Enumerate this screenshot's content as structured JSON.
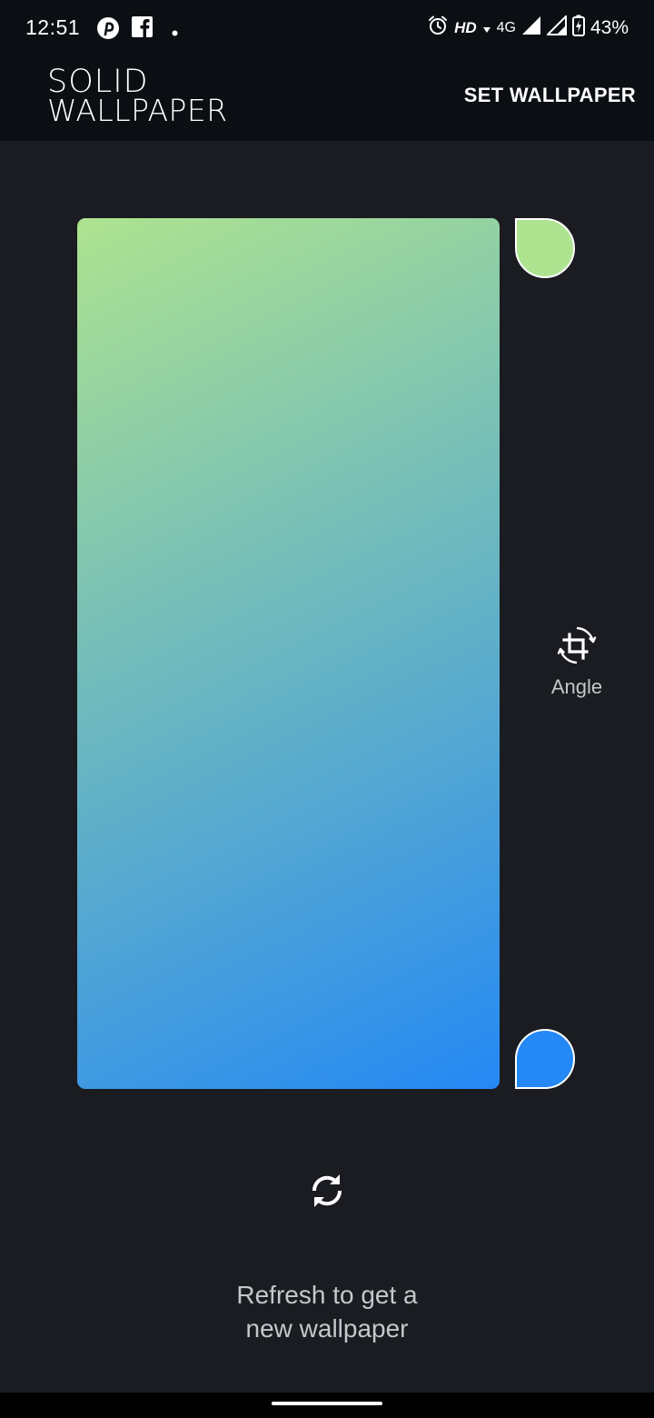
{
  "status_bar": {
    "time": "12:51",
    "icons_left": [
      "pinterest-icon",
      "facebook-icon",
      "notification-dot-icon"
    ],
    "hd": "HD",
    "network": "4G",
    "battery": "43%",
    "icons_right": [
      "alarm-icon",
      "signal-icon",
      "signal-icon",
      "battery-charging-icon"
    ]
  },
  "appbar": {
    "logo_line1": "SOLID",
    "logo_line2": "WALLPAPER",
    "set_wallpaper_label": "SET WALLPAPER"
  },
  "gradient": {
    "start_color": "#aee38f",
    "end_color": "#2488f5",
    "direction": "top-left to bottom-right"
  },
  "angle": {
    "label": "Angle",
    "icon": "crop-rotate-icon"
  },
  "refresh": {
    "icon": "refresh-icon",
    "hint_line1": "Refresh to get a",
    "hint_line2": "new wallpaper"
  }
}
